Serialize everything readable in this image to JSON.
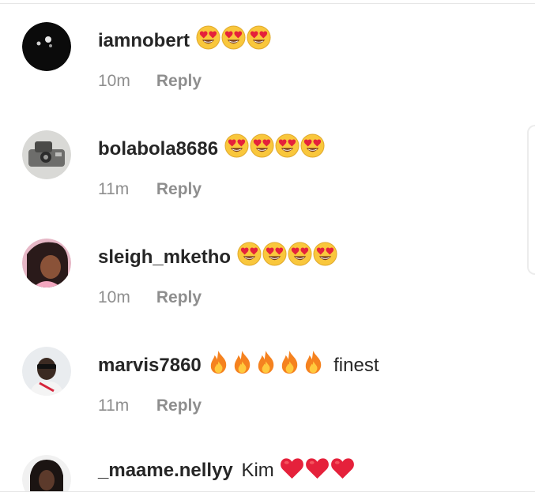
{
  "comments": [
    {
      "username": "iamnobert",
      "text": "",
      "emojis": [
        "heart-eyes-emoji",
        "heart-eyes-emoji",
        "heart-eyes-emoji"
      ],
      "time": "10m",
      "reply_label": "Reply",
      "avatar": "dark-avatar"
    },
    {
      "username": "bolabola8686",
      "text": "",
      "emojis": [
        "heart-eyes-emoji",
        "heart-eyes-emoji",
        "heart-eyes-emoji",
        "heart-eyes-emoji"
      ],
      "time": "11m",
      "reply_label": "Reply",
      "avatar": "photo-avatar-grey"
    },
    {
      "username": "sleigh_mketho",
      "text": "",
      "emojis": [
        "heart-eyes-emoji",
        "heart-eyes-emoji",
        "heart-eyes-emoji",
        "heart-eyes-emoji"
      ],
      "time": "10m",
      "reply_label": "Reply",
      "avatar": "photo-avatar-pink"
    },
    {
      "username": "marvis7860",
      "text": "finest",
      "emojis": [
        "fire-emoji",
        "fire-emoji",
        "fire-emoji",
        "fire-emoji",
        "fire-emoji"
      ],
      "time": "11m",
      "reply_label": "Reply",
      "avatar": "photo-avatar-sunglasses"
    },
    {
      "username": "_maame.nellyy",
      "text": "Kim",
      "emojis": [
        "red-heart-emoji",
        "red-heart-emoji",
        "red-heart-emoji"
      ],
      "time": "",
      "reply_label": "",
      "avatar": "photo-avatar-dark"
    }
  ],
  "colors": {
    "username": "#262626",
    "meta": "#8e8e8e",
    "heart_eyes_face": "#f9c73c",
    "heart": "#e5213b",
    "fire_outer": "#f5821f",
    "fire_inner": "#ffc93d"
  }
}
